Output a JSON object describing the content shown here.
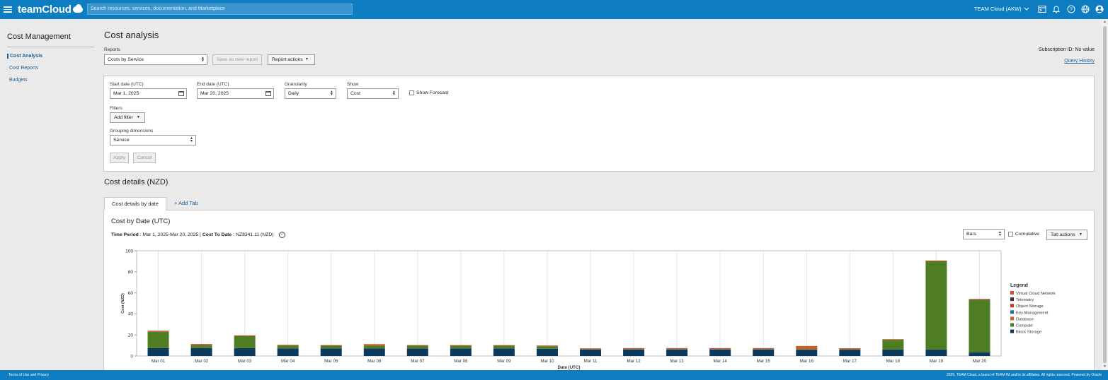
{
  "header": {
    "brand": "teamCloud",
    "search_placeholder": "Search resources, services, documentation, and Marketplace",
    "tenant": "TEAM Cloud (AKW)"
  },
  "sidebar": {
    "title": "Cost Management",
    "items": [
      {
        "label": "Cost Analysis",
        "active": true
      },
      {
        "label": "Cost Reports",
        "active": false
      },
      {
        "label": "Budgets",
        "active": false
      }
    ]
  },
  "page": {
    "title": "Cost analysis",
    "reports_label": "Reports",
    "report_value": "Costs by Service",
    "save_new_label": "Save as new report",
    "report_actions_label": "Report actions",
    "subscription": "Subscription ID: No value",
    "query_history": "Query History"
  },
  "filters": {
    "start_label": "Start date (UTC)",
    "start_value": "Mar 1, 2025",
    "end_label": "End date (UTC)",
    "end_value": "Mar 20, 2025",
    "granularity_label": "Granularity",
    "granularity_value": "Daily",
    "show_label": "Show",
    "show_value": "Cost",
    "forecast_label": "Show Forecast",
    "filters_label": "Filters",
    "add_filter_label": "Add filter",
    "grouping_label": "Grouping dimensions",
    "grouping_value": "Service",
    "apply_label": "Apply",
    "cancel_label": "Cancel"
  },
  "details": {
    "title": "Cost details (NZD)",
    "tabs": [
      "Cost details by date",
      "+ Add Tab"
    ],
    "chart_title": "Cost by Date (UTC)",
    "period_label": "Time Period",
    "period_value": ": Mar 1, 2025-Mar 20, 2025 |",
    "cost_label": "Cost To Date",
    "cost_value": ": NZ$341.11 (NZD)",
    "chart_mode": "Bars",
    "cumulative_label": "Cumulative",
    "tab_actions_label": "Tab actions"
  },
  "colors": {
    "brand_blue": "#0d7cc1",
    "Block Storage": "#0b3a5e",
    "Compute": "#4f7d23",
    "Database": "#c0662a",
    "Key Management": "#2f6fb0",
    "Object Storage": "#c53b2a",
    "Telemetry": "#333333",
    "Virtual Cloud Network": "#d24a3a"
  },
  "chart_data": {
    "type": "bar",
    "stacked": true,
    "xlabel": "Date (UTC)",
    "ylabel": "Cost (NZD)",
    "ylim": [
      0,
      100
    ],
    "yticks": [
      0,
      20,
      40,
      60,
      80,
      100
    ],
    "legend_title": "Legend",
    "legend_position": "right",
    "grid": true,
    "categories": [
      "Mar 01",
      "Mar 02",
      "Mar 03",
      "Mar 04",
      "Mar 05",
      "Mar 06",
      "Mar 07",
      "Mar 08",
      "Mar 09",
      "Mar 10",
      "Mar 11",
      "Mar 12",
      "Mar 13",
      "Mar 14",
      "Mar 15",
      "Mar 16",
      "Mar 17",
      "Mar 18",
      "Mar 19",
      "Mar 20"
    ],
    "series": [
      {
        "name": "Block Storage",
        "values": [
          7.5,
          7.5,
          7.5,
          7.2,
          7.2,
          7.2,
          7.2,
          7.2,
          7.2,
          6.8,
          6.2,
          6.2,
          6.2,
          6.2,
          6.2,
          6.0,
          6.0,
          6.2,
          6.2,
          3.5
        ]
      },
      {
        "name": "Compute",
        "values": [
          15.5,
          2.8,
          11.5,
          2.8,
          2.6,
          2.6,
          2.6,
          2.5,
          2.5,
          2.5,
          0.3,
          0.3,
          0.3,
          0.3,
          0.3,
          0.3,
          0.3,
          9.2,
          84.0,
          50.0
        ]
      },
      {
        "name": "Database",
        "values": [
          0.8,
          0.8,
          0.4,
          0.4,
          0.3,
          1.2,
          0.4,
          0.4,
          0.4,
          0.4,
          0.5,
          0.8,
          0.8,
          0.8,
          0.8,
          3.0,
          0.8,
          0.3,
          0.3,
          0.3
        ]
      },
      {
        "name": "Key Management",
        "values": [
          0,
          0,
          0,
          0,
          0,
          0,
          0,
          0,
          0,
          0,
          0,
          0,
          0,
          0,
          0,
          0,
          0,
          0,
          0,
          0.2
        ]
      },
      {
        "name": "Object Storage",
        "values": [
          0.1,
          0.1,
          0.1,
          0.1,
          0.1,
          0.1,
          0.1,
          0.1,
          0.1,
          0.1,
          0.1,
          0.1,
          0.1,
          0.1,
          0.1,
          0.1,
          0.1,
          0.1,
          0.1,
          0.1
        ]
      },
      {
        "name": "Telemetry",
        "values": [
          0,
          0,
          0,
          0,
          0,
          0,
          0,
          0,
          0,
          0,
          0,
          0,
          0,
          0,
          0,
          0,
          0,
          0,
          0,
          0
        ]
      },
      {
        "name": "Virtual Cloud Network",
        "values": [
          0.1,
          0.1,
          0.1,
          0.1,
          0.1,
          0.1,
          0.1,
          0.1,
          0.1,
          0.1,
          0.1,
          0.1,
          0.1,
          0.1,
          0.1,
          0.1,
          0.1,
          0.1,
          0.1,
          0.1
        ]
      }
    ],
    "legend_order": [
      "Virtual Cloud Network",
      "Telemetry",
      "Object Storage",
      "Key Management",
      "Database",
      "Compute",
      "Block Storage"
    ]
  },
  "footer": {
    "left": "Terms of Use and Privacy",
    "right": "2025, TEAM Cloud, a brand of TEAM IM and/or its affiliates. All rights reserved.   Powered by Oracle"
  }
}
